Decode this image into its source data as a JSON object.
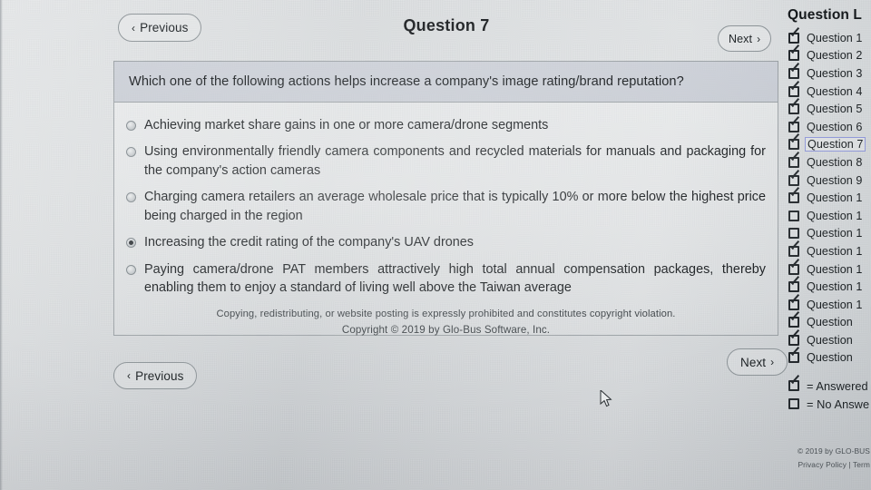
{
  "nav": {
    "prev_label": "Previous",
    "next_label": "Next",
    "chevron_left": "‹",
    "chevron_right": "›"
  },
  "header": {
    "question_title": "Question 7"
  },
  "question": {
    "prompt": "Which one of the following actions helps increase a company's image rating/brand reputation?",
    "selected_index": 3,
    "options": [
      {
        "label": "Achieving market share gains in one or more camera/drone segments",
        "selected": false
      },
      {
        "label": "Using environmentally friendly camera components and recycled materials for manuals and packaging for the company's action cameras",
        "selected": false
      },
      {
        "label": "Charging camera retailers an average wholesale price that is typically 10% or more below the highest price being charged in the region",
        "selected": false
      },
      {
        "label": "Increasing the credit rating of the company's UAV drones",
        "selected": true
      },
      {
        "label": "Paying camera/drone PAT members attractively high total annual compensation packages, thereby enabling them to enjoy a standard of living well above the Taiwan average",
        "selected": false
      }
    ],
    "notice_line1": "Copying, redistributing, or website posting is expressly prohibited and constitutes copyright violation.",
    "notice_line2": "Copyright © 2019 by Glo-Bus Software, Inc."
  },
  "sidebar": {
    "title": "Question L",
    "items": [
      {
        "label": "Question 1",
        "answered": true,
        "current": false
      },
      {
        "label": "Question 2",
        "answered": true,
        "current": false
      },
      {
        "label": "Question 3",
        "answered": true,
        "current": false
      },
      {
        "label": "Question 4",
        "answered": true,
        "current": false
      },
      {
        "label": "Question 5",
        "answered": true,
        "current": false
      },
      {
        "label": "Question 6",
        "answered": true,
        "current": false
      },
      {
        "label": "Question 7",
        "answered": true,
        "current": true
      },
      {
        "label": "Question 8",
        "answered": true,
        "current": false
      },
      {
        "label": "Question 9",
        "answered": true,
        "current": false
      },
      {
        "label": "Question 1",
        "answered": true,
        "current": false
      },
      {
        "label": "Question 1",
        "answered": false,
        "current": false
      },
      {
        "label": "Question 1",
        "answered": false,
        "current": false
      },
      {
        "label": "Question 1",
        "answered": true,
        "current": false
      },
      {
        "label": "Question 1",
        "answered": true,
        "current": false
      },
      {
        "label": "Question 1",
        "answered": true,
        "current": false
      },
      {
        "label": "Question 1",
        "answered": true,
        "current": false
      },
      {
        "label": "Question",
        "answered": true,
        "current": false
      },
      {
        "label": "Question",
        "answered": true,
        "current": false
      },
      {
        "label": "Question",
        "answered": true,
        "current": false
      }
    ],
    "legend": [
      {
        "label": "= Answered",
        "answered": true
      },
      {
        "label": "= No Answe",
        "answered": false
      }
    ],
    "footer_line1": "© 2019 by GLO-BUS",
    "footer_line2": "Privacy Policy | Term"
  },
  "colors": {
    "page_bg": "#cdd1d3",
    "card_header_bg": "#b6bbc7",
    "text": "#15191c",
    "border": "#9aa0a4",
    "current_outline": "#9098d8",
    "checkbox": "#23282c"
  }
}
